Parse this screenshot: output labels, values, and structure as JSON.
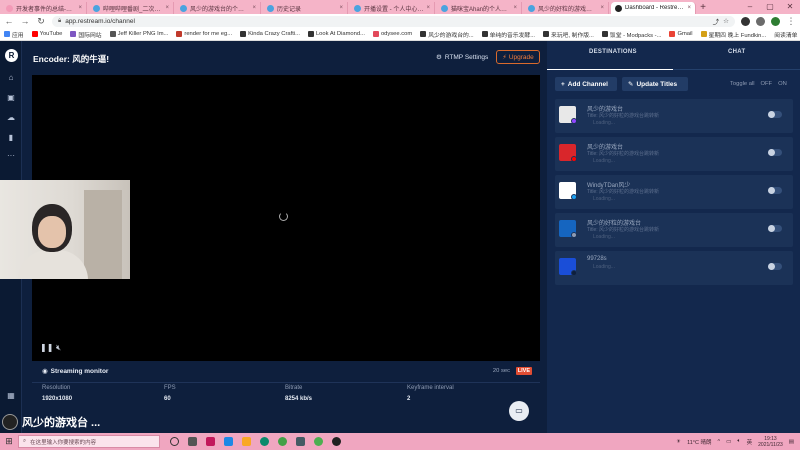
{
  "browser": {
    "tabs": [
      {
        "title": "开发者事件的总结-哔哩哔",
        "color": "#f39ab7"
      },
      {
        "title": "哔哩哔哩番剧_二次元番剧",
        "color": "#4aa3df"
      },
      {
        "title": "风少的游戏台的个人空间_",
        "color": "#4aa3df"
      },
      {
        "title": "历史记录",
        "color": "#4aa3df"
      },
      {
        "title": "开播设置 - 个人中心 - bili",
        "color": "#4aa3df"
      },
      {
        "title": "猫咪宝Ahan的个人空间_哔",
        "color": "#4aa3df"
      },
      {
        "title": "风少的好粒的游戏台跳转新",
        "color": "#4aa3df"
      },
      {
        "title": "Dashboard - Restream",
        "color": "#222222"
      }
    ],
    "active_tab_index": 7,
    "address": "app.restream.io/channel",
    "bookmarks": [
      {
        "label": "应用",
        "color": "#4285f4"
      },
      {
        "label": "YouTube",
        "color": "#ff0000"
      },
      {
        "label": "国际网站",
        "color": "#7e57c2"
      },
      {
        "label": "Jeff Killer PNG Im...",
        "color": "#555555"
      },
      {
        "label": "render for me eg...",
        "color": "#c0392b"
      },
      {
        "label": "Kinda Crazy Crafti...",
        "color": "#333333"
      },
      {
        "label": "Look At Diamond...",
        "color": "#333333"
      },
      {
        "label": "odysee.com",
        "color": "#e2495b"
      },
      {
        "label": "风少的游戏台的...",
        "color": "#333333"
      },
      {
        "label": "单纯的音乐发酵...",
        "color": "#333333"
      },
      {
        "label": "来玩吧, 制作版...",
        "color": "#333333"
      },
      {
        "label": "饭堂 - Modpacks -...",
        "color": "#333333"
      },
      {
        "label": "Gmail",
        "color": "#ea4335"
      },
      {
        "label": "星期四 晚上 Fundkin...",
        "color": "#d4a017"
      }
    ],
    "bookmarks_right": "阅读清单"
  },
  "app": {
    "logo_letter": "R",
    "nav_icons": [
      "home-icon",
      "studio-icon",
      "cloud-icon",
      "analytics-icon",
      "more-icon"
    ],
    "encoder_title": "Encoder: 风的牛逼!",
    "rtmp_label": "RTMP Settings",
    "upgrade_label": "Upgrade",
    "monitor_label": "Streaming monitor",
    "monitor_time": "20 sec",
    "live_label": "LIVE",
    "stats": [
      {
        "key": "Resolution",
        "value": "1920x1080"
      },
      {
        "key": "FPS",
        "value": "60"
      },
      {
        "key": "Bitrate",
        "value": "8254 kb/s"
      },
      {
        "key": "Keyframe interval",
        "value": "2"
      }
    ]
  },
  "panel": {
    "tab_destinations": "DESTINATIONS",
    "tab_chat": "CHAT",
    "add_channel": "Add Channel",
    "update_titles": "Update Titles",
    "toggle_all": "Toggle all",
    "off": "OFF",
    "on": "ON",
    "destinations": [
      {
        "name": "风少的游戏台",
        "title": "Title: 风少的好粒的游戏台跳转新",
        "status": "Loading...",
        "avatar_color": "#e8e8e8",
        "badge_color": "#9146ff"
      },
      {
        "name": "风少的游戏台",
        "title": "Title: 风少的好粒的游戏台跳转新",
        "status": "Loading...",
        "avatar_color": "#d9262b",
        "badge_color": "#ff0000"
      },
      {
        "name": "WindyTDan风少",
        "title": "Title: 风少的好粒的游戏台跳转新",
        "status": "Loading...",
        "avatar_color": "#ffffff",
        "badge_color": "#1da1f2"
      },
      {
        "name": "风少的好粒的游戏台",
        "title": "Title: 风少的好粒的游戏台跳转新",
        "status": "Loading...",
        "avatar_color": "#1565c0",
        "badge_color": "#8e9bb3"
      },
      {
        "name": "99728s",
        "title": "",
        "status": "Loading...",
        "avatar_color": "#1a4ed8",
        "badge_color": "#0e1f3d"
      }
    ]
  },
  "overlay": {
    "streamer_name": "风少的游戏台 ..."
  },
  "taskbar": {
    "search_placeholder": "在这里输入你要搜索的内容",
    "weather": "11°C 晴朗",
    "time": "19:13",
    "date": "2021/11/23"
  }
}
